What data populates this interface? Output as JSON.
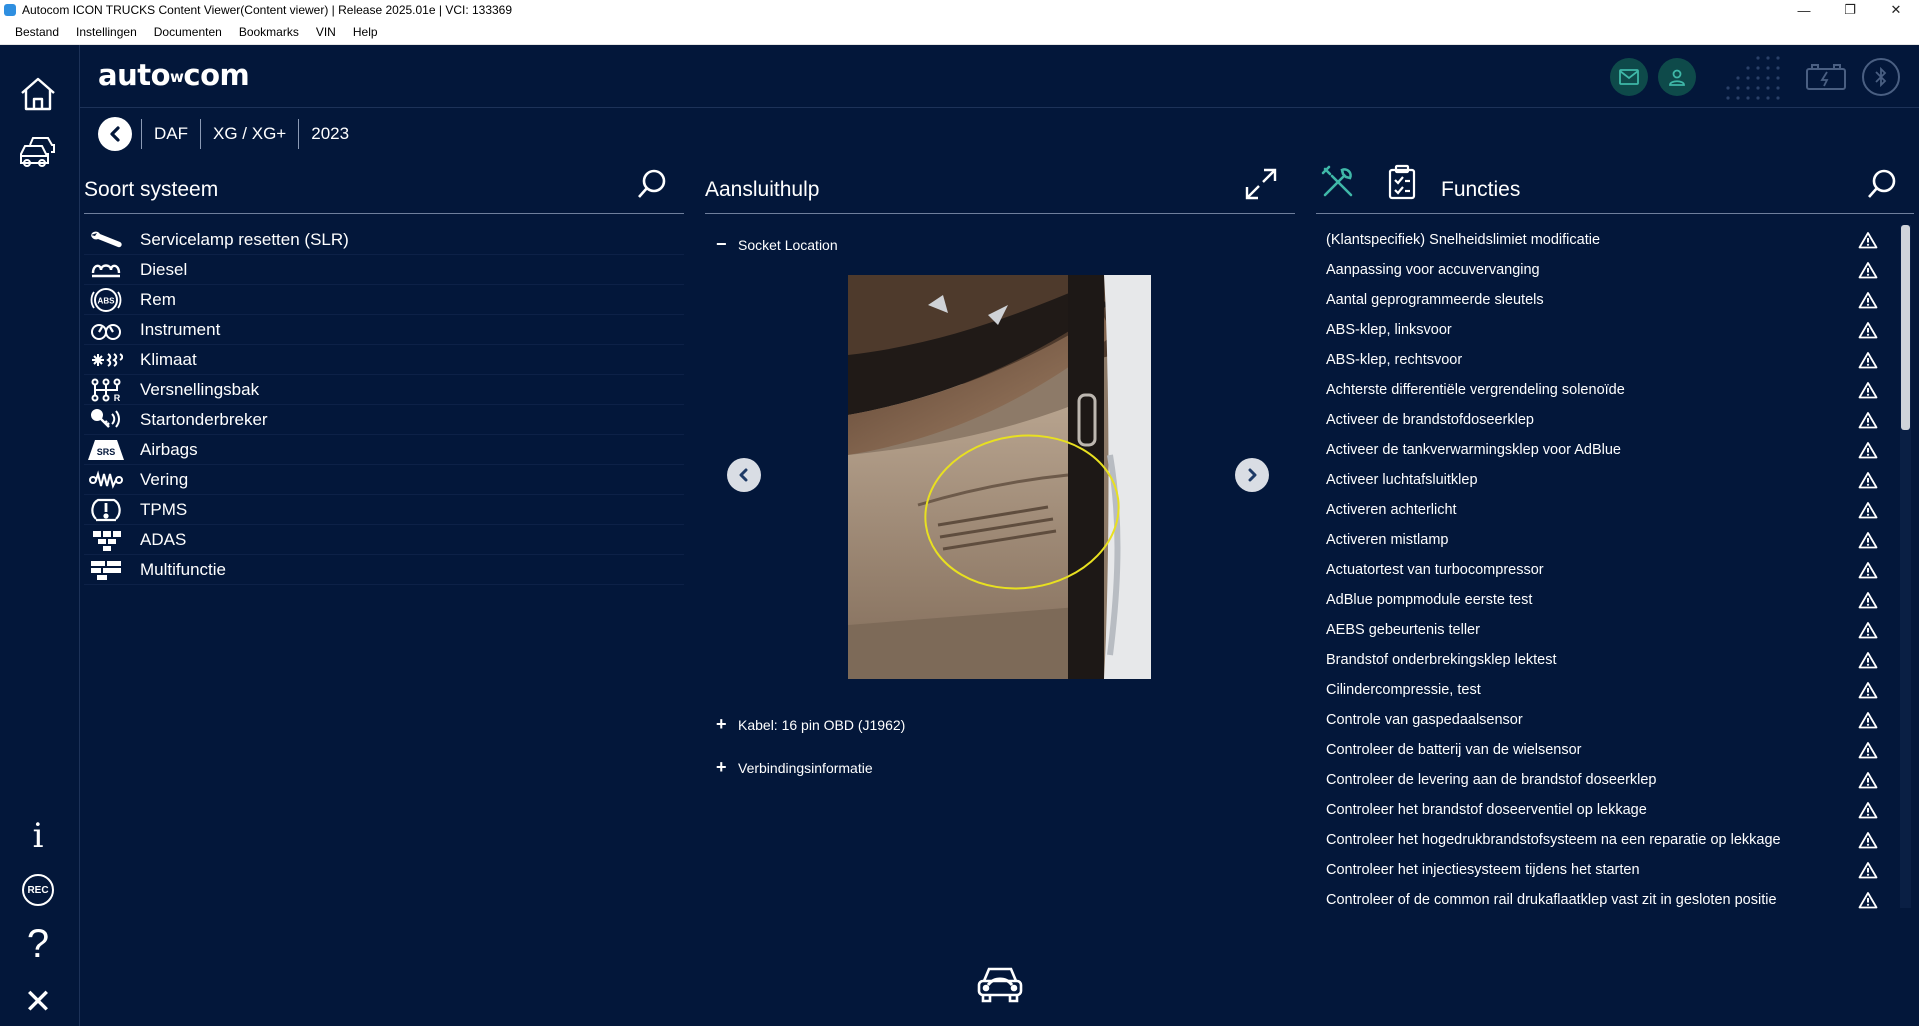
{
  "window": {
    "title": "Autocom ICON TRUCKS Content Viewer(Content viewer) | Release 2025.01e | VCI: 133369",
    "controls": [
      "—",
      "❐",
      "✕"
    ]
  },
  "menu": [
    "Bestand",
    "Instellingen",
    "Documenten",
    "Bookmarks",
    "VIN",
    "Help"
  ],
  "logo": {
    "text_a": "auto",
    "text_b": "w",
    "text_c": "com"
  },
  "breadcrumb": [
    "DAF",
    "XG / XG+",
    "2023"
  ],
  "left_panel": {
    "title": "Soort systeem",
    "items": [
      {
        "label": "Servicelamp resetten (SLR)",
        "icon": "wrench-icon"
      },
      {
        "label": "Diesel",
        "icon": "glow-plug-icon"
      },
      {
        "label": "Rem",
        "icon": "abs-icon"
      },
      {
        "label": "Instrument",
        "icon": "gauge-icon"
      },
      {
        "label": "Klimaat",
        "icon": "climate-icon"
      },
      {
        "label": "Versnellingsbak",
        "icon": "gearbox-icon"
      },
      {
        "label": "Startonderbreker",
        "icon": "immobilizer-icon"
      },
      {
        "label": "Airbags",
        "icon": "srs-icon"
      },
      {
        "label": "Vering",
        "icon": "suspension-icon"
      },
      {
        "label": "TPMS",
        "icon": "tpms-icon"
      },
      {
        "label": "ADAS",
        "icon": "adas-icon"
      },
      {
        "label": "Multifunctie",
        "icon": "multifunction-icon"
      }
    ],
    "abs_text": "ABS",
    "srs_text": "SRS"
  },
  "middle_panel": {
    "title": "Aansluithulp",
    "socket_location": "Socket Location",
    "cable": "Kabel: 16 pin OBD (J1962)",
    "connection_info": "Verbindingsinformatie",
    "minus": "−",
    "plus": "+"
  },
  "right_panel": {
    "title": "Functies",
    "items": [
      "(Klantspecifiek) Snelheidslimiet modificatie",
      "Aanpassing voor accuvervanging",
      "Aantal geprogrammeerde sleutels",
      "ABS-klep, linksvoor",
      "ABS-klep, rechtsvoor",
      "Achterste differentiële vergrendeling solenoïde",
      "Activeer de brandstofdoseerklep",
      "Activeer de tankverwarmingsklep voor AdBlue",
      "Activeer luchtafsluitklep",
      "Activeren achterlicht",
      "Activeren mistlamp",
      "Actuatortest van turbocompressor",
      "AdBlue pompmodule eerste test",
      "AEBS gebeurtenis teller",
      "Brandstof onderbrekingsklep lektest",
      "Cilindercompressie, test",
      "Controle van gaspedaalsensor",
      "Controleer de batterij van de wielsensor",
      "Controleer de levering aan de brandstof doseerklep",
      "Controleer het brandstof doseerventiel op lekkage",
      "Controleer het hogedrukbrandstofsysteem na een reparatie op lekkage",
      "Controleer het injectiesysteem tijdens het starten",
      "Controleer of de common rail drukaflaatklep vast zit in gesloten positie"
    ]
  },
  "rail": {
    "info": "i",
    "rec": "REC",
    "help": "?",
    "close": "✕"
  },
  "colors": {
    "background": "#03173a",
    "accent_green": "#3fb8a8",
    "highlight_yellow": "#e8e020"
  }
}
